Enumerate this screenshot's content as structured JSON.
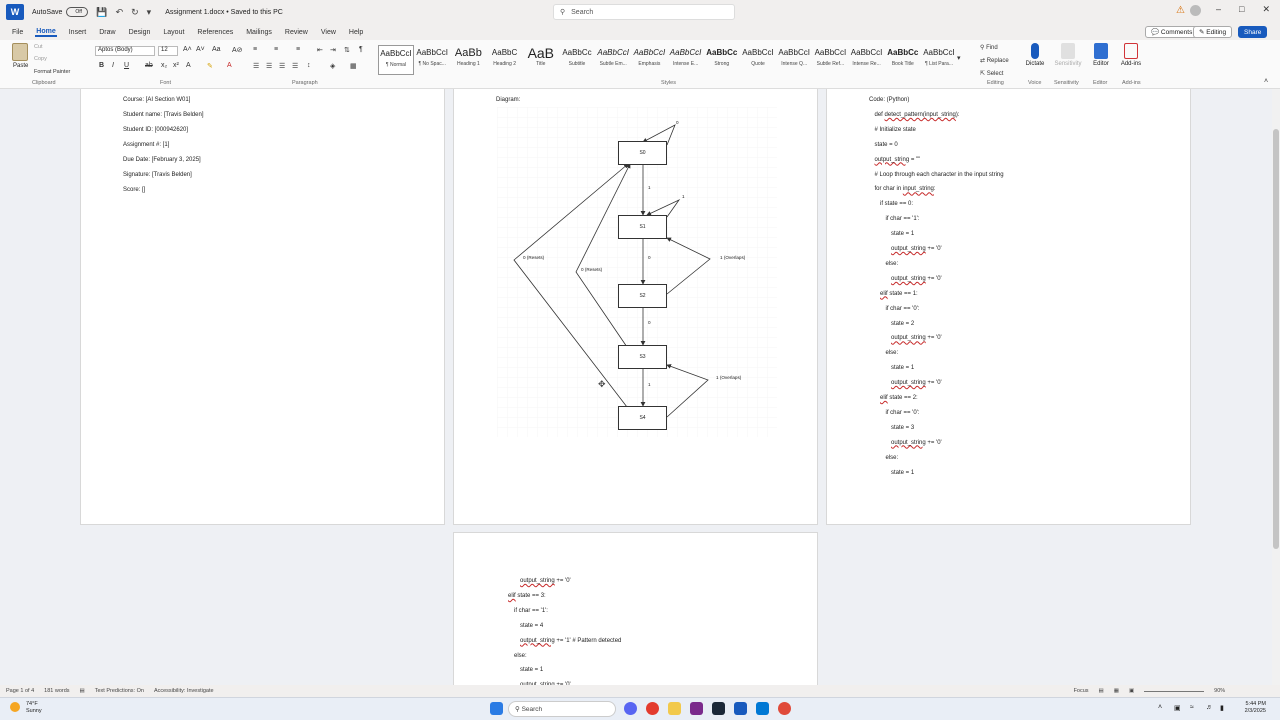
{
  "titlebar": {
    "autosave_label": "AutoSave",
    "autosave_state": "Off",
    "doc_title": "Assignment 1.docx • Saved to this PC",
    "search_placeholder": "Search"
  },
  "menu": {
    "tabs": [
      "File",
      "Home",
      "Insert",
      "Draw",
      "Design",
      "Layout",
      "References",
      "Mailings",
      "Review",
      "View",
      "Help"
    ],
    "comments_label": "Comments",
    "editing_label": "Editing",
    "share_label": "Share"
  },
  "ribbon": {
    "clipboard": {
      "paste": "Paste",
      "cut": "Cut",
      "copy": "Copy",
      "format_painter": "Format Painter",
      "label": "Clipboard"
    },
    "font": {
      "family": "Aptos (Body)",
      "size": "12",
      "label": "Font"
    },
    "paragraph_label": "Paragraph",
    "styles": [
      {
        "sample": "AaBbCcI",
        "name": "¶ Normal"
      },
      {
        "sample": "AaBbCcI",
        "name": "¶ No Spac..."
      },
      {
        "sample": "AaBb",
        "name": "Heading 1"
      },
      {
        "sample": "AaBbC",
        "name": "Heading 2"
      },
      {
        "sample": "AaB",
        "name": "Title"
      },
      {
        "sample": "AaBbCc",
        "name": "Subtitle"
      },
      {
        "sample": "AaBbCcI",
        "name": "Subtle Em..."
      },
      {
        "sample": "AaBbCcI",
        "name": "Emphasis"
      },
      {
        "sample": "AaBbCcI",
        "name": "Intense E..."
      },
      {
        "sample": "AaBbCc",
        "name": "Strong"
      },
      {
        "sample": "AaBbCcI",
        "name": "Quote"
      },
      {
        "sample": "AaBbCcI",
        "name": "Intense Q..."
      },
      {
        "sample": "AaBbCcI",
        "name": "Subtle Ref..."
      },
      {
        "sample": "AaBbCcI",
        "name": "Intense Re..."
      },
      {
        "sample": "AaBbCc",
        "name": "Book Title"
      },
      {
        "sample": "AaBbCcI",
        "name": "¶ List Para..."
      }
    ],
    "styles_label": "Styles",
    "editing": {
      "find": "Find",
      "replace": "Replace",
      "select": "Select",
      "label": "Editing"
    },
    "voice": {
      "dictate": "Dictate",
      "label": "Voice"
    },
    "sensitivity": {
      "name": "Sensitivity",
      "label": "Sensitivity"
    },
    "editor": {
      "name": "Editor",
      "label": "Editor"
    },
    "addins": {
      "name": "Add-ins",
      "label": "Add-ins"
    }
  },
  "page1": {
    "lines": [
      "Course: [AI Section W01]",
      "Student name: [Travis Belden]",
      "Student ID: [000942620]",
      "Assignment #: [1]",
      "Due Date: [February 3, 2025]",
      "Signature: [Travis Belden]",
      "Score: []"
    ]
  },
  "page2": {
    "heading": "Diagram:",
    "states": [
      "S0",
      "S1",
      "S2",
      "S3",
      "S4"
    ],
    "edge_labels": {
      "s0_loop": "0",
      "s0_s1": "1",
      "s1_loop": "1",
      "s1_s2": "0",
      "s2_s3": "0",
      "s3_s4": "1",
      "reset_outer": "0 (Resets)",
      "reset_inner": "0 (Resets)",
      "overlap_s2": "1 (Overlaps)",
      "overlap_s4": "1 (Overlaps)"
    }
  },
  "page3": {
    "lines": [
      {
        "indent": 0,
        "parts": [
          {
            "t": "Code: (Python)"
          }
        ]
      },
      {
        "indent": 1,
        "parts": [
          {
            "t": "def "
          },
          {
            "t": "detect_pattern(input_string",
            "sq": true
          },
          {
            "t": "):"
          }
        ]
      },
      {
        "indent": 1,
        "parts": [
          {
            "t": "# Initialize state"
          }
        ]
      },
      {
        "indent": 1,
        "parts": [
          {
            "t": "state = 0"
          }
        ]
      },
      {
        "indent": 1,
        "parts": [
          {
            "t": "output_string",
            "sq": true
          },
          {
            "t": " = \"\""
          }
        ]
      },
      {
        "indent": 1,
        "parts": [
          {
            "t": "# Loop through each character in the input string"
          }
        ]
      },
      {
        "indent": 1,
        "parts": [
          {
            "t": "for char in "
          },
          {
            "t": "input_string",
            "sq": true
          },
          {
            "t": ":"
          }
        ]
      },
      {
        "indent": 2,
        "parts": [
          {
            "t": "if state == 0:"
          }
        ]
      },
      {
        "indent": 3,
        "parts": [
          {
            "t": "if char == '1':"
          }
        ]
      },
      {
        "indent": 4,
        "parts": [
          {
            "t": "state = 1"
          }
        ]
      },
      {
        "indent": 4,
        "parts": [
          {
            "t": "output_string",
            "sq": true
          },
          {
            "t": " += '0'"
          }
        ]
      },
      {
        "indent": 3,
        "parts": [
          {
            "t": "else:"
          }
        ]
      },
      {
        "indent": 4,
        "parts": [
          {
            "t": "output_string",
            "sq": true
          },
          {
            "t": " += '0'"
          }
        ]
      },
      {
        "indent": 2,
        "parts": [
          {
            "t": "elif",
            "sq": true
          },
          {
            "t": " state == 1:"
          }
        ]
      },
      {
        "indent": 3,
        "parts": [
          {
            "t": "if char == '0':"
          }
        ]
      },
      {
        "indent": 4,
        "parts": [
          {
            "t": "state = 2"
          }
        ]
      },
      {
        "indent": 4,
        "parts": [
          {
            "t": "output_string",
            "sq": true
          },
          {
            "t": " += '0'"
          }
        ]
      },
      {
        "indent": 3,
        "parts": [
          {
            "t": "else:"
          }
        ]
      },
      {
        "indent": 4,
        "parts": [
          {
            "t": "state = 1"
          }
        ]
      },
      {
        "indent": 4,
        "parts": [
          {
            "t": "output_string",
            "sq": true
          },
          {
            "t": " += '0'"
          }
        ]
      },
      {
        "indent": 2,
        "parts": [
          {
            "t": "elif",
            "sq": true
          },
          {
            "t": " state == 2:"
          }
        ]
      },
      {
        "indent": 3,
        "parts": [
          {
            "t": "if char == '0':"
          }
        ]
      },
      {
        "indent": 4,
        "parts": [
          {
            "t": "state = 3"
          }
        ]
      },
      {
        "indent": 4,
        "parts": [
          {
            "t": "output_string",
            "sq": true
          },
          {
            "t": " += '0'"
          }
        ]
      },
      {
        "indent": 3,
        "parts": [
          {
            "t": "else:"
          }
        ]
      },
      {
        "indent": 4,
        "parts": [
          {
            "t": "state = 1"
          }
        ]
      }
    ]
  },
  "page4": {
    "lines": [
      {
        "indent": 2,
        "parts": [
          {
            "t": "output_string",
            "sq": true
          },
          {
            "t": " += '0'"
          }
        ]
      },
      {
        "indent": 0,
        "parts": [
          {
            "t": "elif",
            "sq": true
          },
          {
            "t": " state == 3:"
          }
        ]
      },
      {
        "indent": 1,
        "parts": [
          {
            "t": "if char == '1':"
          }
        ]
      },
      {
        "indent": 2,
        "parts": [
          {
            "t": "state = 4"
          }
        ]
      },
      {
        "indent": 2,
        "parts": [
          {
            "t": "output_string",
            "sq": true
          },
          {
            "t": " += '1' "
          },
          {
            "t": " # Pattern detected"
          }
        ]
      },
      {
        "indent": 1,
        "parts": [
          {
            "t": "else:"
          }
        ]
      },
      {
        "indent": 2,
        "parts": [
          {
            "t": "state = 1"
          }
        ]
      },
      {
        "indent": 2,
        "parts": [
          {
            "t": "output_string",
            "sq": true
          },
          {
            "t": " += '0'"
          }
        ]
      }
    ]
  },
  "statusbar": {
    "page": "Page 1 of 4",
    "words": "181 words",
    "text_predictions": "Text Predictions: On",
    "accessibility": "Accessibility: Investigate",
    "focus": "Focus",
    "zoom": "90%"
  },
  "taskbar": {
    "temp": "74°F",
    "weather": "Sunny",
    "search": "Search",
    "time": "5:44 PM",
    "date": "2/3/2025"
  },
  "colors": {
    "accent": "#185abd",
    "squiggle": "#c62828"
  }
}
